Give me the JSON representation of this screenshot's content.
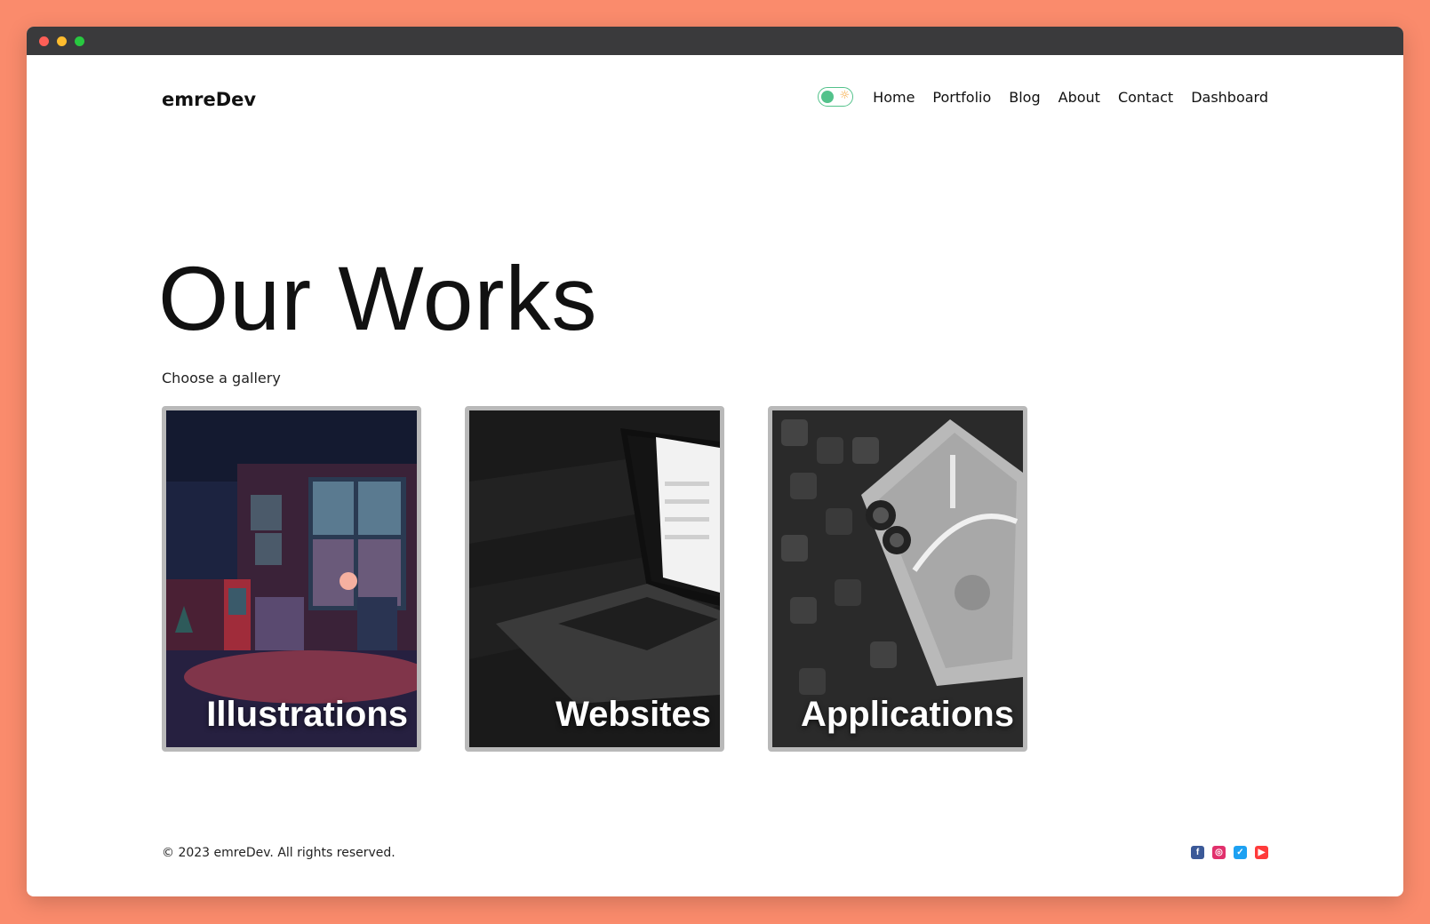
{
  "header": {
    "logo": "emreDev",
    "nav": {
      "home": "Home",
      "portfolio": "Portfolio",
      "blog": "Blog",
      "about": "About",
      "contact": "Contact",
      "dashboard": "Dashboard"
    },
    "theme_toggle": {
      "icon": "sun-icon",
      "accent": "#53c28b"
    }
  },
  "hero": {
    "title": "Our Works",
    "subtitle": "Choose a gallery"
  },
  "galleries": [
    {
      "label": "Illustrations"
    },
    {
      "label": "Websites"
    },
    {
      "label": "Applications"
    }
  ],
  "footer": {
    "copyright": "© 2023 emreDev. All rights reserved.",
    "socials": [
      {
        "icon": "facebook-icon",
        "color": "#3b5998"
      },
      {
        "icon": "instagram-icon",
        "color": "#e1306c"
      },
      {
        "icon": "twitter-icon",
        "color": "#1da1f2"
      },
      {
        "icon": "youtube-icon",
        "color": "#ff0000"
      }
    ]
  },
  "colors": {
    "background": "#fa8b6c",
    "card_border": "#b9b9b9"
  }
}
